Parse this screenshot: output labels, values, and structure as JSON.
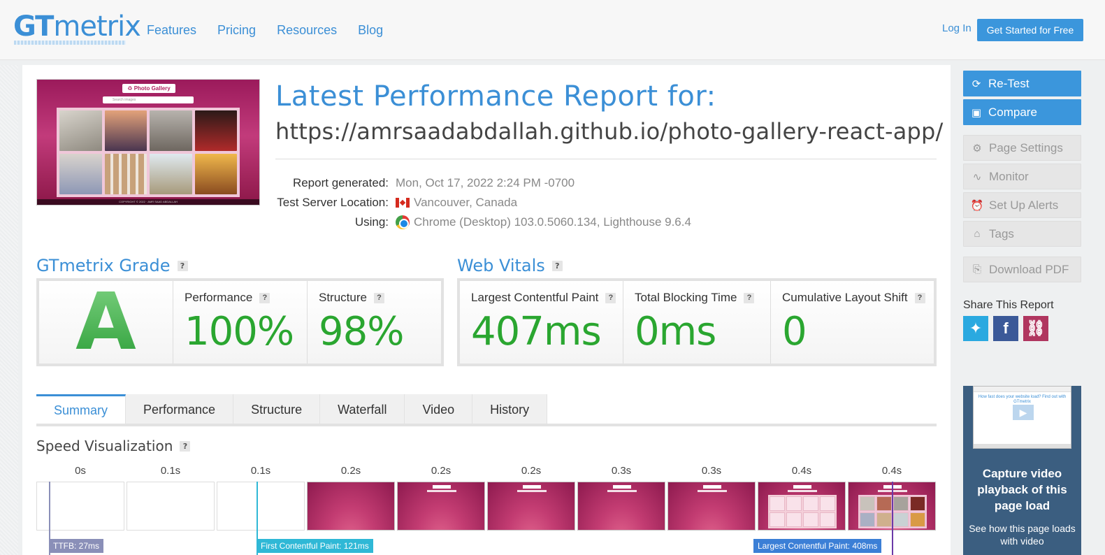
{
  "header": {
    "logo_bold": "GT",
    "logo_light": "metrix",
    "nav": [
      "Features",
      "Pricing",
      "Resources",
      "Blog"
    ],
    "login": "Log In",
    "cta": "Get Started for Free"
  },
  "report": {
    "title": "Latest Performance Report for:",
    "url": "https://amrsaadabdallah.github.io/photo-gallery-react-app/",
    "generated_label": "Report generated:",
    "generated_value": "Mon, Oct 17, 2022 2:24 PM -0700",
    "server_label": "Test Server Location:",
    "server_value": "Vancouver, Canada",
    "using_label": "Using:",
    "using_value": "Chrome (Desktop) 103.0.5060.134, Lighthouse 9.6.4"
  },
  "thumbnail": {
    "title": "♻ Photo Gallery",
    "search_placeholder": "Search images",
    "footer": "COPYRIGHT © 2022 · AMR SAAD ABDALLAH"
  },
  "grade": {
    "title": "GTmetrix Grade",
    "letter": "A",
    "performance_label": "Performance",
    "performance_value": "100%",
    "structure_label": "Structure",
    "structure_value": "98%"
  },
  "vitals": {
    "title": "Web Vitals",
    "lcp_label": "Largest Contentful Paint",
    "lcp_value": "407ms",
    "tbt_label": "Total Blocking Time",
    "tbt_value": "0ms",
    "cls_label": "Cumulative Layout Shift",
    "cls_value": "0"
  },
  "help": "?",
  "tabs": [
    "Summary",
    "Performance",
    "Structure",
    "Waterfall",
    "Video",
    "History"
  ],
  "active_tab": "Summary",
  "speed": {
    "title": "Speed Visualization",
    "frames": [
      "0s",
      "0.1s",
      "0.1s",
      "0.2s",
      "0.2s",
      "0.2s",
      "0.3s",
      "0.3s",
      "0.4s",
      "0.4s"
    ],
    "ttfb": "TTFB: 27ms",
    "fcp": "First Contentful Paint: 121ms",
    "lcp": "Largest Contentful Paint: 408ms"
  },
  "sidebar": {
    "retest": "Re-Test",
    "compare": "Compare",
    "page_settings": "Page Settings",
    "monitor": "Monitor",
    "alerts": "Set Up Alerts",
    "tags": "Tags",
    "pdf": "Download PDF",
    "share_label": "Share This Report",
    "promo_screen_text": "How fast does your website load? Find out with GTmetrix",
    "promo_title": "Capture video playback of this page load",
    "promo_sub": "See how this page loads with video"
  },
  "colors": {
    "accent": "#3b8fd6",
    "good": "#2aa630",
    "button": "#3b96dc",
    "ttfb_marker": "#8a8fb8",
    "fcp_marker": "#2fb8d6",
    "lcp_marker": "#3b7fd6"
  }
}
